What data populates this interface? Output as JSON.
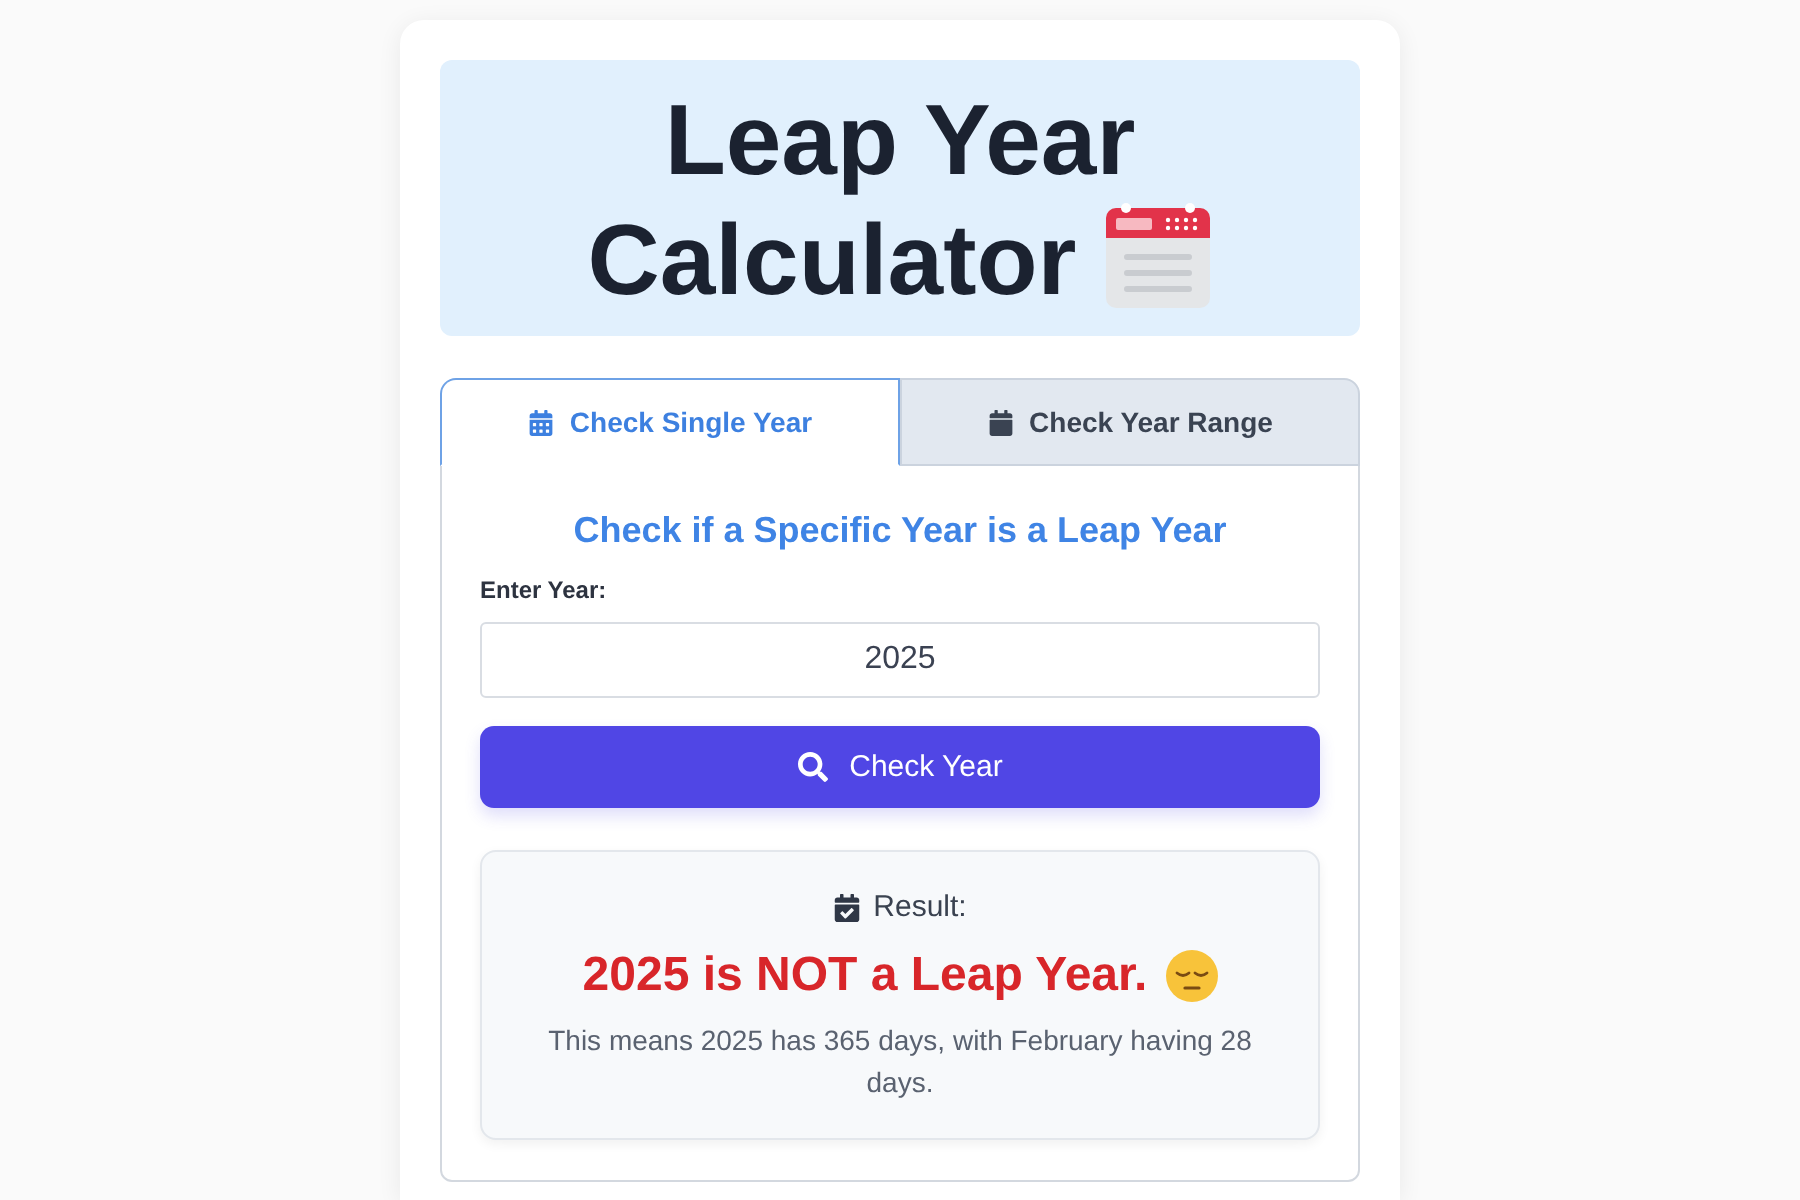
{
  "title": {
    "text": "Leap Year Calculator"
  },
  "tabs": [
    {
      "label": "Check Single Year",
      "selected": true
    },
    {
      "label": "Check Year Range",
      "selected": false
    }
  ],
  "single_year": {
    "heading": "Check if a Specific Year is a Leap Year",
    "field_label": "Enter Year:",
    "year_input": {
      "value": "2025"
    },
    "button": "Check Year",
    "result": {
      "label": "Result:",
      "verdict": "2025 is NOT a Leap Year.",
      "is_leap": false,
      "explanation": "This means 2025 has 365 days, with February having 28 days."
    }
  }
}
